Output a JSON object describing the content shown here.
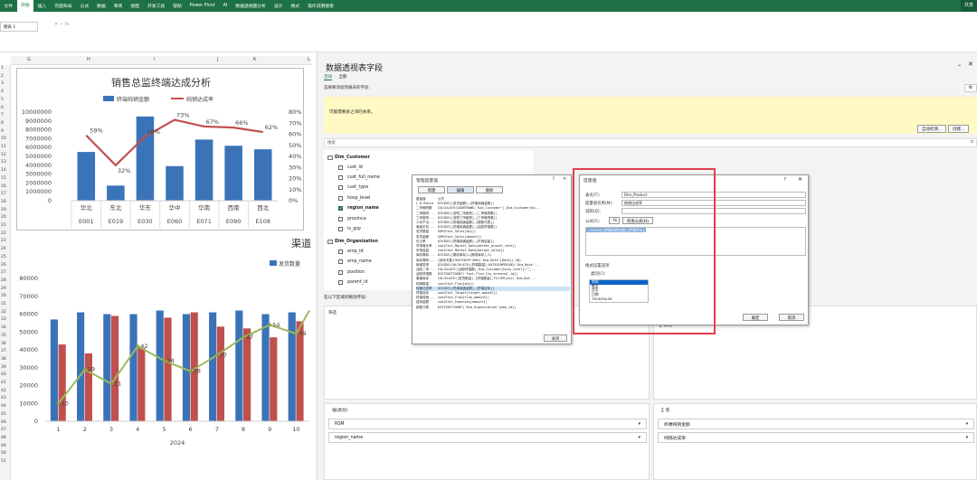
{
  "ribbon": {
    "tabs": [
      "文件",
      "开始",
      "插入",
      "页面布局",
      "公式",
      "数据",
      "审阅",
      "视图",
      "开发工具",
      "帮助",
      "Power Pivot",
      "AI",
      "数据透视图分析",
      "设计",
      "格式",
      "操作说明搜索"
    ],
    "selected": "开始",
    "share": "共享"
  },
  "namebox": "图表 1",
  "fx": "fx",
  "columns": [
    "G",
    "H",
    "I",
    "J",
    "K",
    "L"
  ],
  "rows": [
    "1",
    "2",
    "3",
    "4",
    "5",
    "6",
    "7",
    "8",
    "9",
    "10",
    "11",
    "12",
    "13",
    "14",
    "15",
    "16",
    "17",
    "18",
    "19",
    "20",
    "21",
    "22",
    "23",
    "24",
    "25",
    "26",
    "27",
    "28",
    "29",
    "30",
    "31",
    "32",
    "33",
    "34",
    "35",
    "36",
    "37",
    "38",
    "39",
    "40",
    "41",
    "42",
    "43",
    "44",
    "45",
    "46",
    "47",
    "48",
    "49",
    "50",
    "51"
  ],
  "chart_data": [
    {
      "type": "bar",
      "title": "销售总监终端达成分析",
      "categories": [
        "E001",
        "E019",
        "E030",
        "E060",
        "E071",
        "E090",
        "E108"
      ],
      "regions": [
        "华北",
        "东北",
        "华东",
        "华中",
        "华南",
        "西南",
        "西北"
      ],
      "series": [
        {
          "name": "终端纯销金额",
          "type": "bar",
          "values": [
            5500000,
            1700000,
            9500000,
            3900000,
            6900000,
            6200000,
            5800000
          ],
          "color": "#3b73b9"
        },
        {
          "name": "纯销达成率",
          "type": "line",
          "values": [
            59,
            32,
            58,
            73,
            67,
            66,
            62
          ],
          "labels": [
            "59%",
            "32%",
            "58%",
            "73%",
            "67%",
            "66%",
            "62%"
          ],
          "color": "#c0504d",
          "axis": "right"
        }
      ],
      "ylim": [
        0,
        10000000
      ],
      "y2lim": [
        0,
        80
      ],
      "yticks": [
        "0",
        "1000000",
        "2000000",
        "3000000",
        "4000000",
        "5000000",
        "6000000",
        "7000000",
        "8000000",
        "9000000",
        "10000000"
      ],
      "y2ticks": [
        "0%",
        "10%",
        "20%",
        "30%",
        "40%",
        "50%",
        "60%",
        "70%",
        "80%"
      ]
    },
    {
      "type": "bar",
      "title": "渠道发",
      "categories": [
        "1",
        "2",
        "3",
        "4",
        "5",
        "6",
        "7",
        "8",
        "9",
        "10"
      ],
      "xlabel": "2024",
      "series": [
        {
          "name": "发货数量",
          "values": [
            57000,
            61000,
            60000,
            60000,
            62000,
            60000,
            61000,
            62000,
            60000,
            61000
          ],
          "color": "#3b73b9"
        },
        {
          "name": "",
          "values": [
            43000,
            38000,
            59000,
            41000,
            58000,
            61000,
            53000,
            52000,
            47000,
            56000
          ],
          "color": "#c0504d"
        },
        {
          "name": "",
          "type": "line",
          "values": [
            10,
            29,
            21,
            42,
            34,
            28,
            37,
            47,
            54,
            49
          ],
          "labels": [
            "10",
            "29",
            "21",
            "42",
            "34",
            "28",
            "37",
            "47",
            "54",
            "49"
          ],
          "color": "#9bbb59"
        }
      ],
      "ylim": [
        0,
        80000
      ],
      "yticks": [
        "0",
        "10000",
        "20000",
        "30000",
        "40000",
        "50000",
        "60000",
        "70000",
        "80000"
      ]
    }
  ],
  "pane": {
    "title": "数据透视表字段",
    "tabs": [
      "活动",
      "全部"
    ],
    "hint": "选择要添加到报表的字段:",
    "yellow_msg": "可能需要表之间的关系。",
    "btn_detect": "自动检测...",
    "btn_create": "创建...",
    "search": "搜索",
    "groups": [
      {
        "name": "Dim_Customer",
        "fields": [
          {
            "n": "cust_id",
            "on": false
          },
          {
            "n": "cust_full_name",
            "on": false
          },
          {
            "n": "cust_type",
            "on": false
          },
          {
            "n": "hosp_level",
            "on": false
          },
          {
            "n": "region_name",
            "on": true
          },
          {
            "n": "province",
            "on": false
          },
          {
            "n": "is_gsp",
            "on": false
          }
        ]
      },
      {
        "name": "Dim_Organization",
        "fields": [
          {
            "n": "emp_id",
            "on": false
          },
          {
            "n": "emp_name",
            "on": false
          },
          {
            "n": "position",
            "on": false
          },
          {
            "n": "parent_id",
            "on": false
          }
        ]
      }
    ],
    "drag_hint": "在以下区域间拖动字段:",
    "filter": "筛选",
    "columns_zone": "∑ 数值",
    "axis_zone": "轴(类别)",
    "values_zone": "∑ 值",
    "axis_items": [
      "RSM",
      "region_name"
    ],
    "value_items": [
      "终端纯销金额",
      "纯销达成率"
    ]
  },
  "mgr": {
    "title": "管理度量值",
    "btn_new": "新建",
    "btn_edit": "编辑",
    "btn_del": "删除",
    "col_name": "度量值",
    "col_formula": "公式",
    "close": "关闭",
    "rows": [
      {
        "n": "L-D Ratio",
        "f": "DIVIDE([发货金额],[终端纯销金额])"
      },
      {
        "n": "二甲医院数",
        "f": "CALCULATE(COUNTROWS('Dim_Customer'),Dim_Customer[ho..."
      },
      {
        "n": "二甲医院...",
        "f": "DIVIDE([该院二甲医院],[二甲医院数])"
      },
      {
        "n": "三甲医院...",
        "f": "DIVIDE([该院三甲医院],[三甲医院数])"
      },
      {
        "n": "人均产出...",
        "f": "DIVIDE([终端纯销金额],[销售代表])"
      },
      {
        "n": "单级平均...",
        "f": "DIVIDE([终端纯销金额],[活跃终端数])"
      },
      {
        "n": "发货数量",
        "f": "SUM(Fact_Sales[qty])"
      },
      {
        "n": "发货金额",
        "f": "SUM(Fact_Sales[amount])"
      },
      {
        "n": "在占率",
        "f": "DIVIDE([终端纯销金额],[市场容量])"
      },
      {
        "n": "市场增长率",
        "f": "sum(Fact_Market_Data[market_growth_rate])"
      },
      {
        "n": "市场容量",
        "f": "sum(Fact_Market_Data[market_value])"
      },
      {
        "n": "库存周转...",
        "f": "DIVIDE([期初库存]+[期末库存],2)"
      },
      {
        "n": "库存周转...",
        "f": "[库存天数]*DATEDIFF(MAX('Dim_Date'[Date]),30)"
      },
      {
        "n": "新增发率",
        "f": "DIVIDE(CALCULATE([终端数量],DATESINPERIOD('Dim_Date'..."
      },
      {
        "n": "活跃二甲...",
        "f": "CALCULATE([活跃终端数],Dim_Customer[hosp_level]=\"二..."
      },
      {
        "n": "活跃终端数",
        "f": "DISTINCTCOUNT('Fact_Flow'[to_terminal_id])"
      },
      {
        "n": "渠道库存",
        "f": "CALCULATE([发货数量]-[终端数量],FILTER(ALL('Dim_Dat..."
      },
      {
        "n": "纯销数量",
        "f": "sum(Fact_Flow[qty])"
      },
      {
        "n": "纯销达成率",
        "f": "DIVIDE([终端纯销金额],[终端目标])"
      },
      {
        "n": "终端目标",
        "f": "sum(Fact_Target[target_amount])"
      },
      {
        "n": "终端纯销...",
        "f": "sum(Fact_Flow[flow_amount])"
      },
      {
        "n": "费用金额",
        "f": "sum(Fact_Expenses[amount])"
      },
      {
        "n": "销售代表",
        "f": "DISTINCTCOUNT('Dim_Organization'[emp_id])"
      }
    ],
    "hl_index": 18
  },
  "measure": {
    "title": "度量值",
    "help": "?",
    "close": "✕",
    "table_label": "表名(T):",
    "table_val": "Dim_Product",
    "name_label": "度量值名称(M):",
    "name_val": "纯销达成率",
    "desc_label": "说明(D):",
    "formula_label": "公式(F):",
    "fx_btn": "fx",
    "check_btn": "检查公式(H)",
    "formula": "=DIVIDE([终端纯销金额],[终端目标])",
    "format_section": "格式设置选项",
    "category_label": "类别(C):",
    "categories": [
      "常规",
      "数字",
      "货币",
      "日期",
      "TRUE/FALSE"
    ],
    "ok": "确定",
    "cancel": "取消"
  }
}
